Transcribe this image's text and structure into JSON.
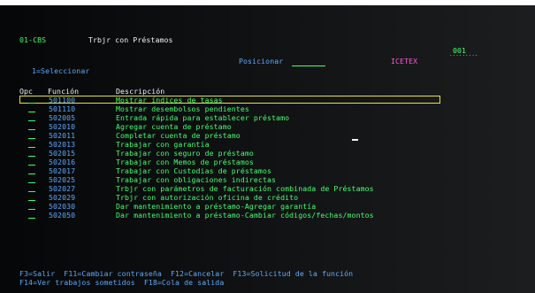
{
  "header": {
    "screen_id": "01-CBS",
    "title": "Trbjr con Préstamos",
    "system_code": "001",
    "position_label": "Posicionar",
    "entity": "ICETEX"
  },
  "options": {
    "select_hint": "1=Seleccionar"
  },
  "table": {
    "headers": {
      "opc": "Opc",
      "funcion": "Función",
      "descripcion": "Descripción"
    },
    "rows": [
      {
        "code": "501100",
        "desc": "Mostrar índices de tasas"
      },
      {
        "code": "501110",
        "desc": "Mostrar desembolsos pendientes"
      },
      {
        "code": "502005",
        "desc": "Entrada rápida para establecer préstamo"
      },
      {
        "code": "502010",
        "desc": "Agregar cuenta de préstamo"
      },
      {
        "code": "502011",
        "desc": "Completar cuenta de préstamo"
      },
      {
        "code": "502013",
        "desc": "Trabajar con garantía"
      },
      {
        "code": "502015",
        "desc": "Trabajar con seguro de préstamo"
      },
      {
        "code": "502016",
        "desc": "Trabajar con Memos de préstamos"
      },
      {
        "code": "502017",
        "desc": "Trabajar con Custodias de préstamos"
      },
      {
        "code": "502025",
        "desc": "Trabajar con obligaciones indirectas"
      },
      {
        "code": "502027",
        "desc": "Trbjr con parámetros de facturación combinada de Préstamos"
      },
      {
        "code": "502029",
        "desc": "Trbjr con autorización oficina de crédito"
      },
      {
        "code": "502030",
        "desc": "Dar mantenimiento a préstamo-Agregar garantía"
      },
      {
        "code": "502050",
        "desc": "Dar mantenimiento a préstamo-Cambiar códigos/fechas/montos"
      }
    ]
  },
  "footer": {
    "line1": "F3=Salir  F11=Cambiar contraseña  F12=Cancelar  F13=Solicitud de la función",
    "line2": "F14=Ver trabajos sometidos  F18=Cola de salida"
  },
  "colors": {
    "background": "#050708",
    "text_green": "#3dff6b",
    "text_white": "#f2f2f2",
    "text_blue": "#5aa8ff",
    "accent_pink": "#ff4dd8",
    "selection_yellow": "#e5e23b"
  }
}
